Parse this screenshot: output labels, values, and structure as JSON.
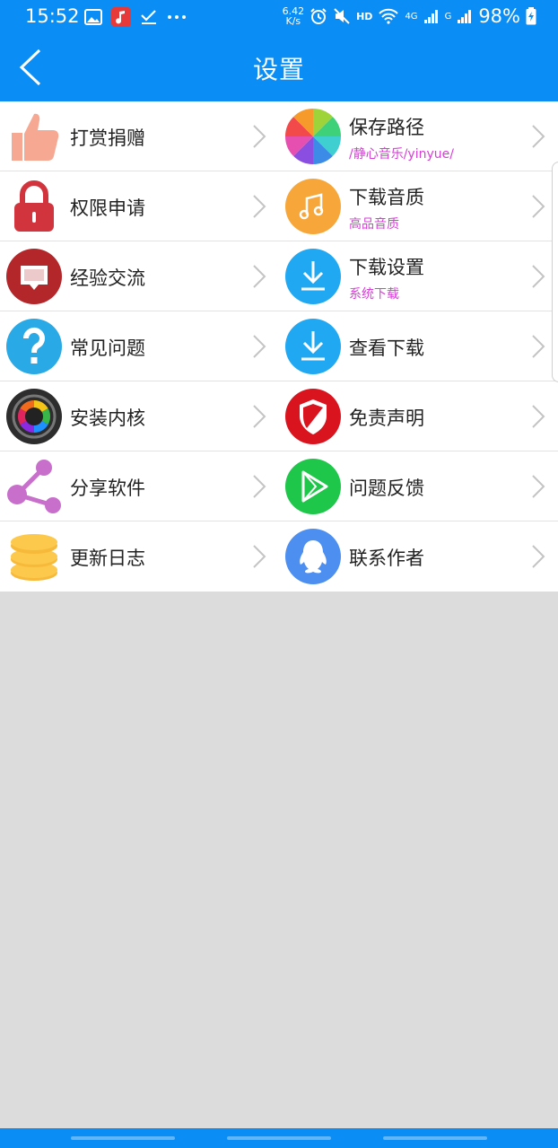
{
  "status_bar": {
    "time": "15:52",
    "net_speed_value": "6.42",
    "net_speed_unit": "K/s",
    "hd": "HD",
    "net_4g": "4G",
    "net_g": "G",
    "battery": "98%",
    "left_icons": [
      "gallery-icon",
      "music-app-icon",
      "check-icon",
      "more-icon"
    ],
    "right_icons": [
      "alarm-icon",
      "mute-icon",
      "wifi-icon",
      "signal-icon",
      "signal-icon",
      "battery-charging-icon"
    ]
  },
  "header": {
    "title": "设置",
    "accent": "#0a8ef5"
  },
  "items": [
    {
      "label": "打赏捐赠",
      "icon": "thumbs-up-icon"
    },
    {
      "label": "保存路径",
      "sub": "/静心音乐/yinyue/",
      "icon": "color-wheel-icon"
    },
    {
      "label": "权限申请",
      "icon": "lock-icon"
    },
    {
      "label": "下载音质",
      "sub": "高品音质",
      "icon": "music-note-icon"
    },
    {
      "label": "经验交流",
      "icon": "chat-icon"
    },
    {
      "label": "下载设置",
      "sub": "系统下载",
      "icon": "download-icon"
    },
    {
      "label": "常见问题",
      "icon": "question-icon"
    },
    {
      "label": "查看下载",
      "icon": "download-icon"
    },
    {
      "label": "安装内核",
      "icon": "lens-icon"
    },
    {
      "label": "免责声明",
      "icon": "shield-icon"
    },
    {
      "label": "分享软件",
      "icon": "share-icon"
    },
    {
      "label": "问题反馈",
      "icon": "play-icon"
    },
    {
      "label": "更新日志",
      "icon": "coins-icon"
    },
    {
      "label": "联系作者",
      "icon": "qq-penguin-icon"
    }
  ],
  "subtitle_color": "#d63fd6"
}
